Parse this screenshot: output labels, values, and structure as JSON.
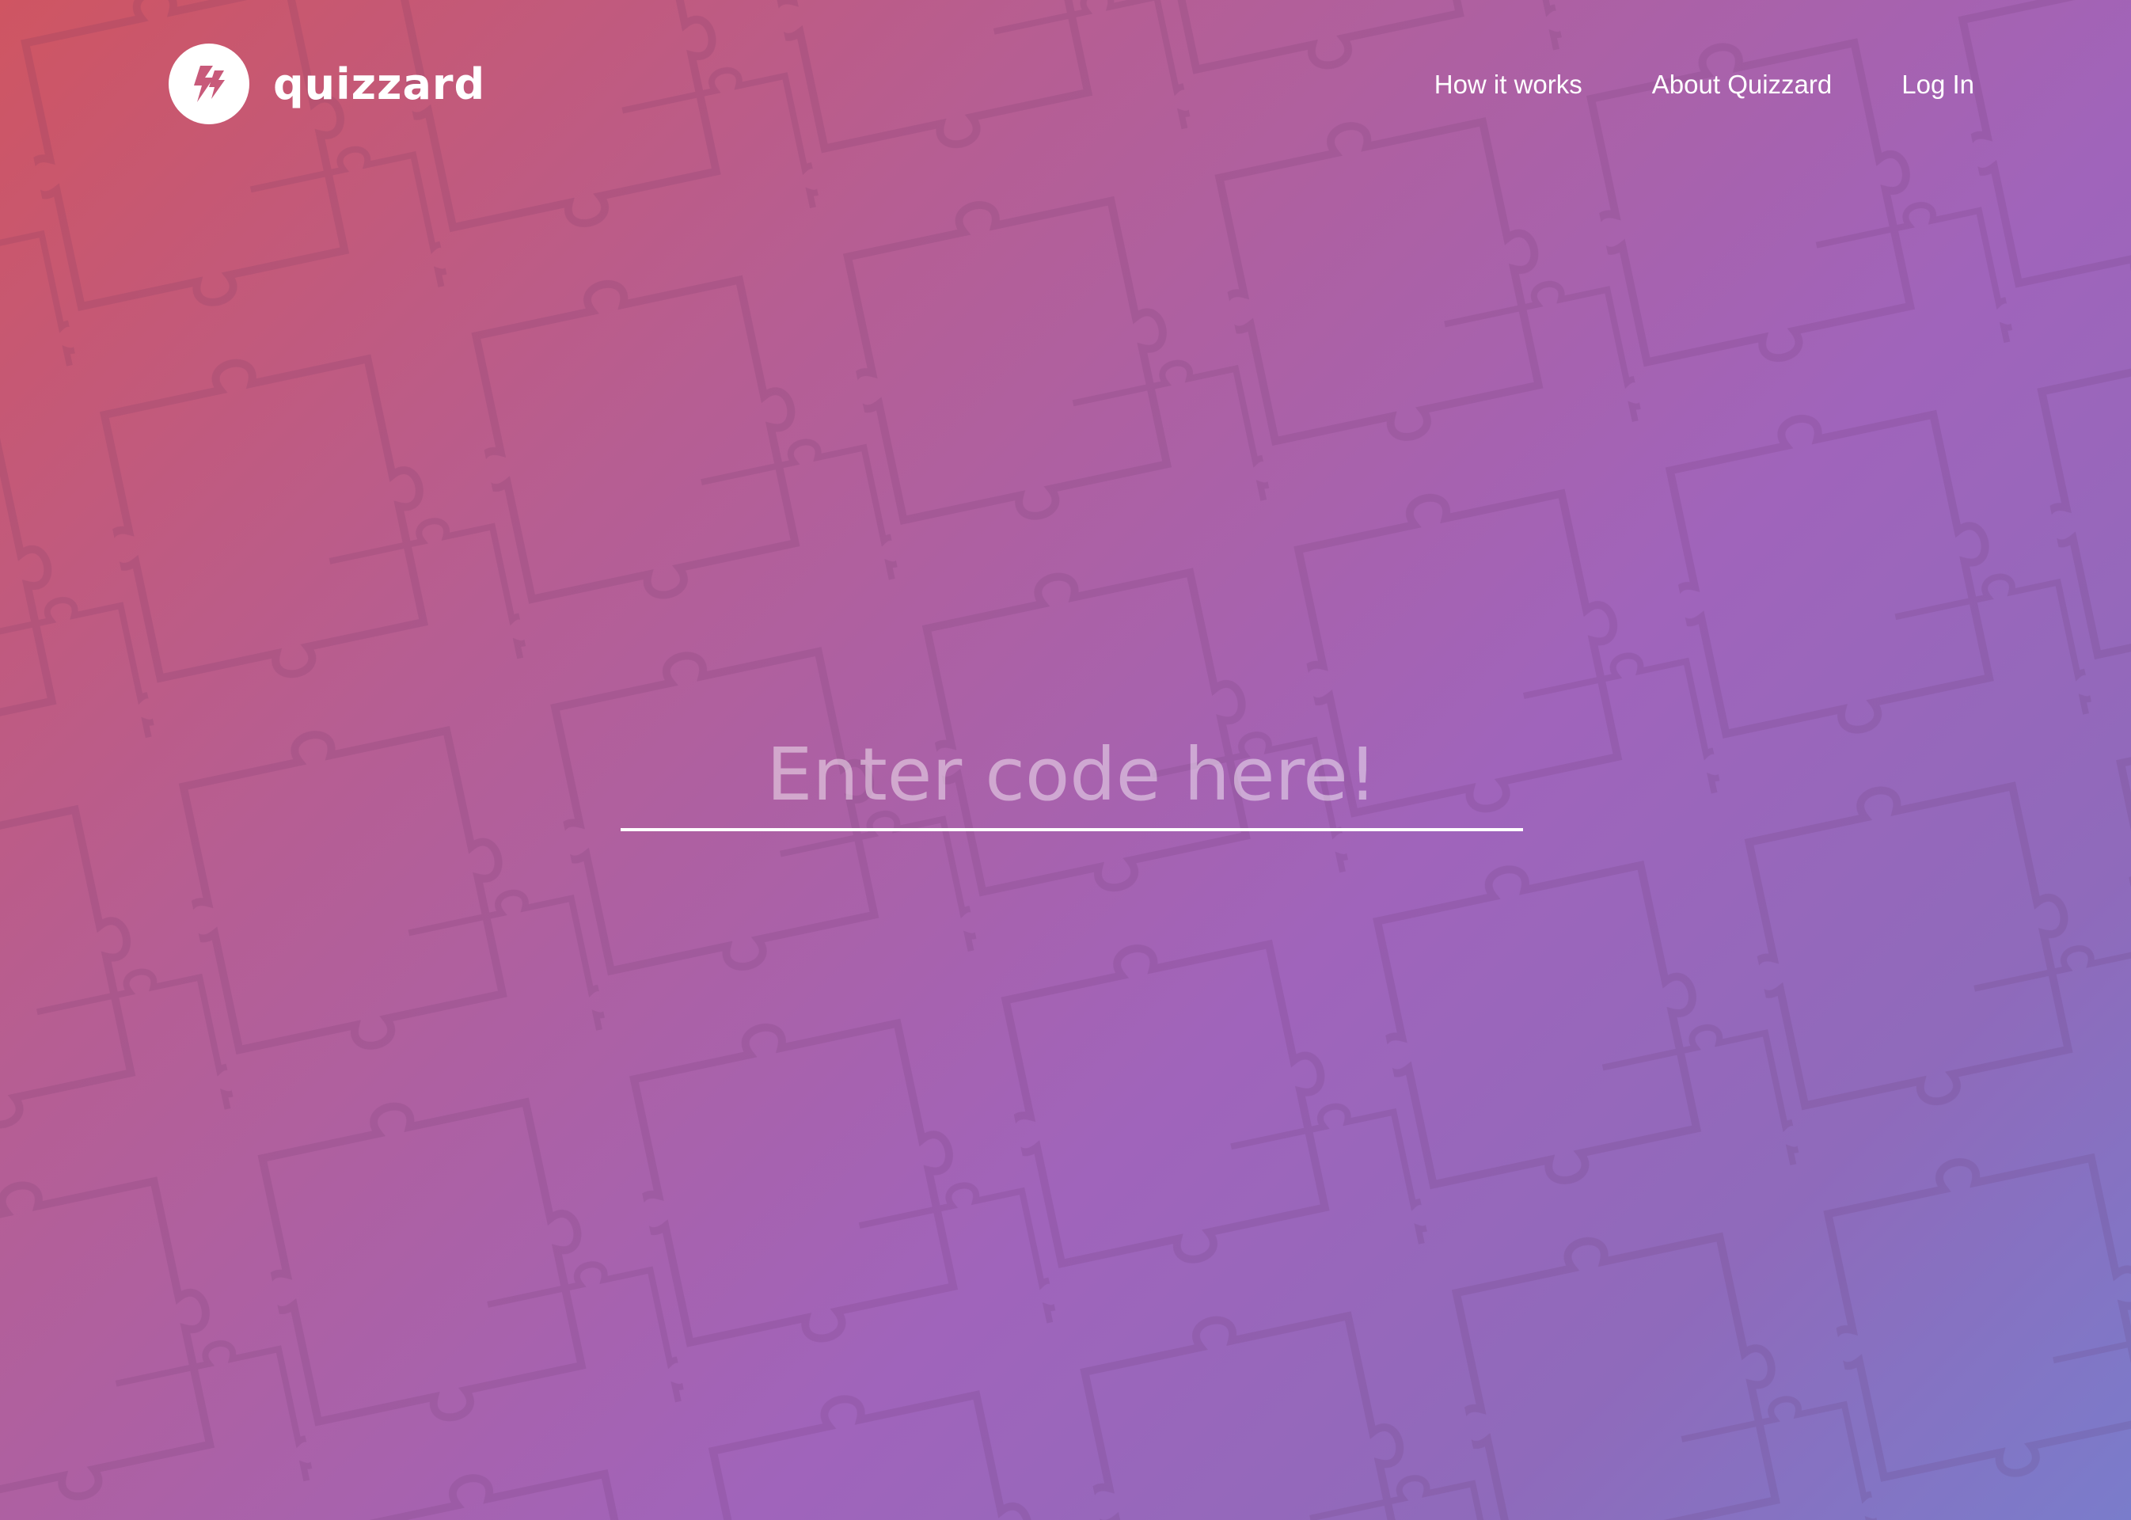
{
  "logo": {
    "text": "quizzard",
    "icon": "lightning-bolts-icon"
  },
  "nav": {
    "items": [
      {
        "label": "How it works"
      },
      {
        "label": "About Quizzard"
      },
      {
        "label": "Log In"
      }
    ]
  },
  "code_entry": {
    "placeholder": "Enter code here!",
    "value": ""
  },
  "theme": {
    "gradient_start": "#cf5562",
    "gradient_mid": "#a064bb",
    "gradient_end": "#7a7ccb",
    "text": "#ffffff",
    "background_pattern": "puzzle-pieces"
  }
}
